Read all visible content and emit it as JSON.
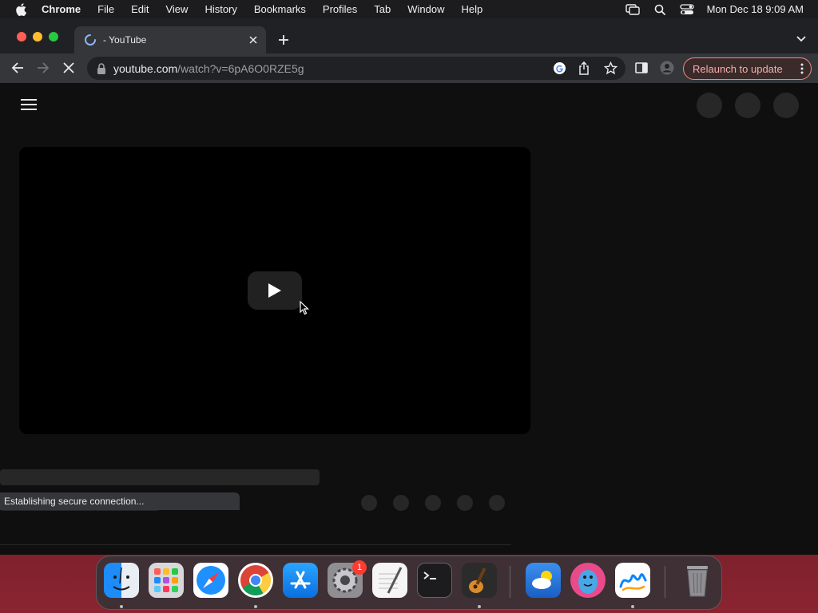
{
  "menubar": {
    "app_name": "Chrome",
    "items": [
      "File",
      "Edit",
      "View",
      "History",
      "Bookmarks",
      "Profiles",
      "Tab",
      "Window",
      "Help"
    ],
    "clock": "Mon Dec 18  9:09 AM"
  },
  "browser": {
    "tab": {
      "title": "- YouTube"
    },
    "address": {
      "domain": "youtube.com",
      "path": "/watch?v=6pA6O0RZE5g"
    },
    "relaunch_label": "Relaunch to update",
    "status_text": "Establishing secure connection..."
  },
  "dock": {
    "apps": [
      {
        "name": "Finder",
        "icon": "finder-icon"
      },
      {
        "name": "Launchpad",
        "icon": "launchpad-icon"
      },
      {
        "name": "Safari",
        "icon": "safari-icon"
      },
      {
        "name": "Google Chrome",
        "icon": "chrome-icon"
      },
      {
        "name": "App Store",
        "icon": "app-store-icon"
      },
      {
        "name": "System Settings",
        "icon": "system-settings-icon",
        "badge": "1"
      },
      {
        "name": "TextEdit",
        "icon": "textedit-icon"
      },
      {
        "name": "Terminal",
        "icon": "terminal-icon"
      },
      {
        "name": "GarageBand",
        "icon": "garageband-icon"
      },
      {
        "name": "Weather",
        "icon": "weather-icon"
      },
      {
        "name": "Bird App",
        "icon": "bird-app-icon"
      },
      {
        "name": "Freeform",
        "icon": "freeform-icon"
      },
      {
        "name": "Trash",
        "icon": "trash-icon"
      }
    ]
  },
  "colors": {
    "page_background": "#0f0f0f",
    "skeleton": "#272727",
    "relaunch_border": "#f28b82"
  }
}
